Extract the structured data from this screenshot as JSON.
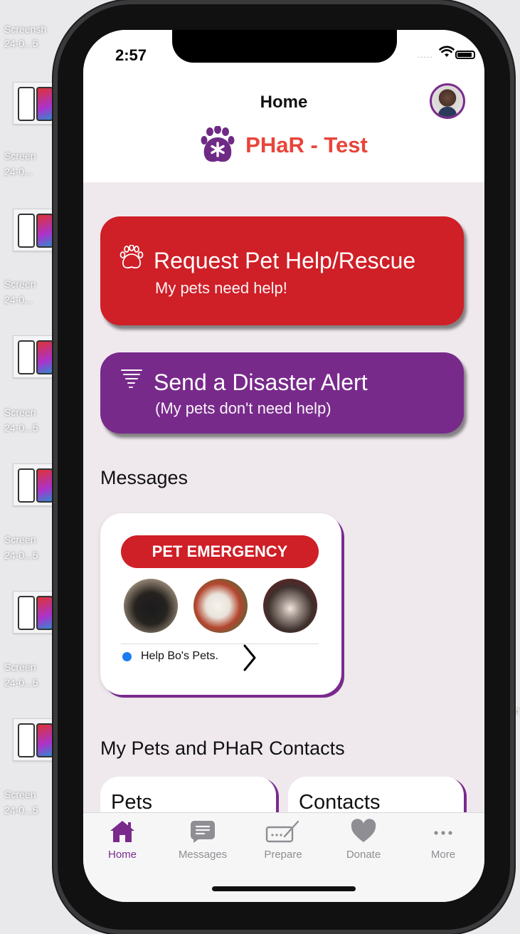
{
  "desktop": {
    "labels": [
      "Screensh",
      "24-0...5",
      "Screen",
      "24-0...",
      "Screen",
      "24-0...",
      "Screen",
      "24-0...5",
      "Screen",
      "24-0...5",
      "Screen",
      "24-0...5",
      "Screen",
      "24-0...5"
    ],
    "right_edge_text": "n"
  },
  "status_bar": {
    "time": "2:57",
    "signal": "....."
  },
  "header": {
    "title": "Home",
    "brand_name": "PHaR - Test"
  },
  "actions": [
    {
      "title": "Request Pet Help/Rescue",
      "subtitle": "My pets need help!",
      "icon": "paw-outline-icon",
      "color": "#cf1f27"
    },
    {
      "title": "Send a Disaster Alert",
      "subtitle": "(My pets don't need help)",
      "icon": "tornado-icon",
      "color": "#782a8b"
    }
  ],
  "messages": {
    "section_title": "Messages",
    "card": {
      "badge": "PET EMERGENCY",
      "pets": [
        "cat",
        "chicken",
        "dog"
      ],
      "text": "Help Bo's Pets.",
      "unread": true
    }
  },
  "pets_contacts": {
    "section_title": "My Pets and PHaR Contacts",
    "cards": [
      "Pets",
      "Contacts"
    ]
  },
  "tabbar": {
    "tabs": [
      {
        "label": "Home",
        "icon": "house-icon",
        "active": true
      },
      {
        "label": "Messages",
        "icon": "chat-bubble-icon",
        "active": false
      },
      {
        "label": "Prepare",
        "icon": "clipboard-pen-icon",
        "active": false
      },
      {
        "label": "Donate",
        "icon": "heart-icon",
        "active": false
      },
      {
        "label": "More",
        "icon": "ellipsis-icon",
        "active": false
      }
    ]
  },
  "colors": {
    "brand_red": "#e8453a",
    "action_red": "#cf1f27",
    "brand_purple": "#782a8b",
    "unread_blue": "#1b7cf2"
  }
}
